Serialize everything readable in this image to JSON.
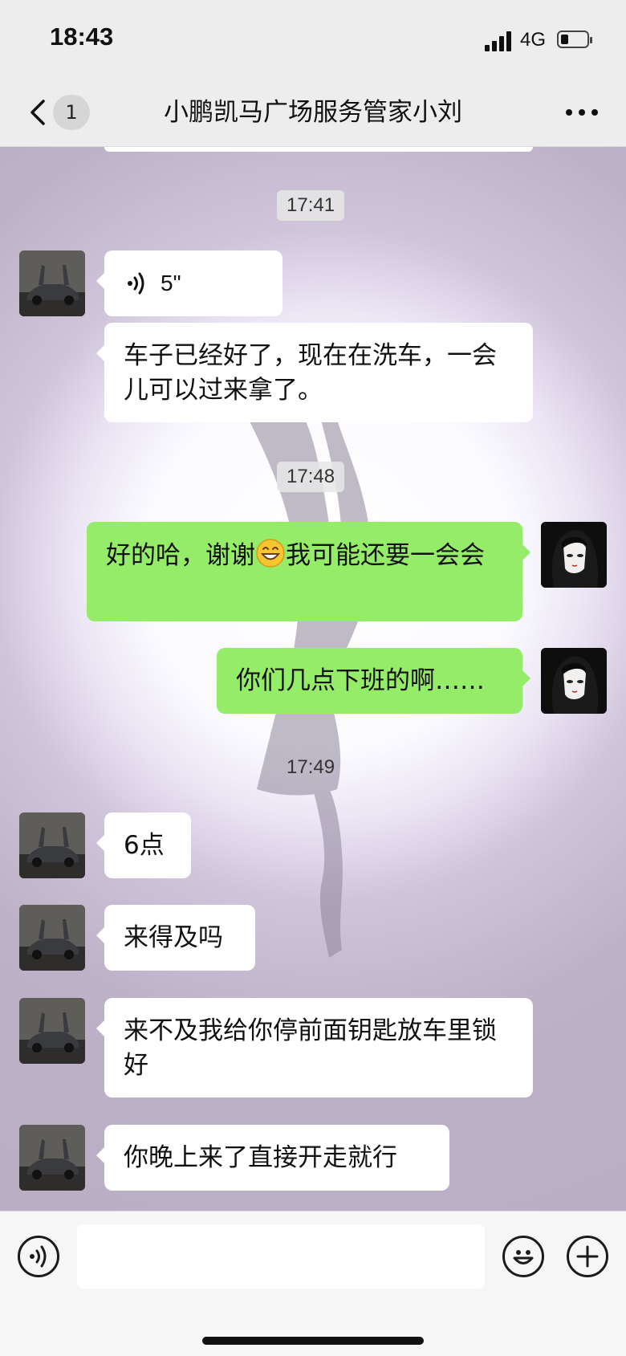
{
  "status_bar": {
    "time": "18:43",
    "network": "4G"
  },
  "nav": {
    "unread_count": "1",
    "title": "小鹏凯马广场服务管家小刘"
  },
  "messages": [
    {
      "kind": "timestamp",
      "text": "17:41"
    },
    {
      "kind": "voice",
      "from": "other",
      "duration": "5\""
    },
    {
      "kind": "text",
      "from": "other",
      "text": "车子已经好了，现在在洗车，一会儿可以过来拿了。"
    },
    {
      "kind": "timestamp",
      "text": "17:48"
    },
    {
      "kind": "text",
      "from": "me",
      "text_before_emoji": "好的哈，谢谢",
      "emoji": "grin-emoji",
      "text_after_emoji": "我可能还要一会会"
    },
    {
      "kind": "text",
      "from": "me",
      "text": "你们几点下班的啊……"
    },
    {
      "kind": "timestamp",
      "text": "17:49"
    },
    {
      "kind": "text",
      "from": "other",
      "text": "6点"
    },
    {
      "kind": "text",
      "from": "other",
      "text": "来得及吗"
    },
    {
      "kind": "text",
      "from": "other",
      "text": "来不及我给你停前面钥匙放车里锁好"
    },
    {
      "kind": "text",
      "from": "other",
      "text": "你晚上来了直接开走就行"
    }
  ],
  "input_bar": {
    "placeholder": ""
  },
  "colors": {
    "outgoing_bubble": "#95ec69",
    "incoming_bubble": "#ffffff",
    "bar_bg": "#ededed"
  }
}
